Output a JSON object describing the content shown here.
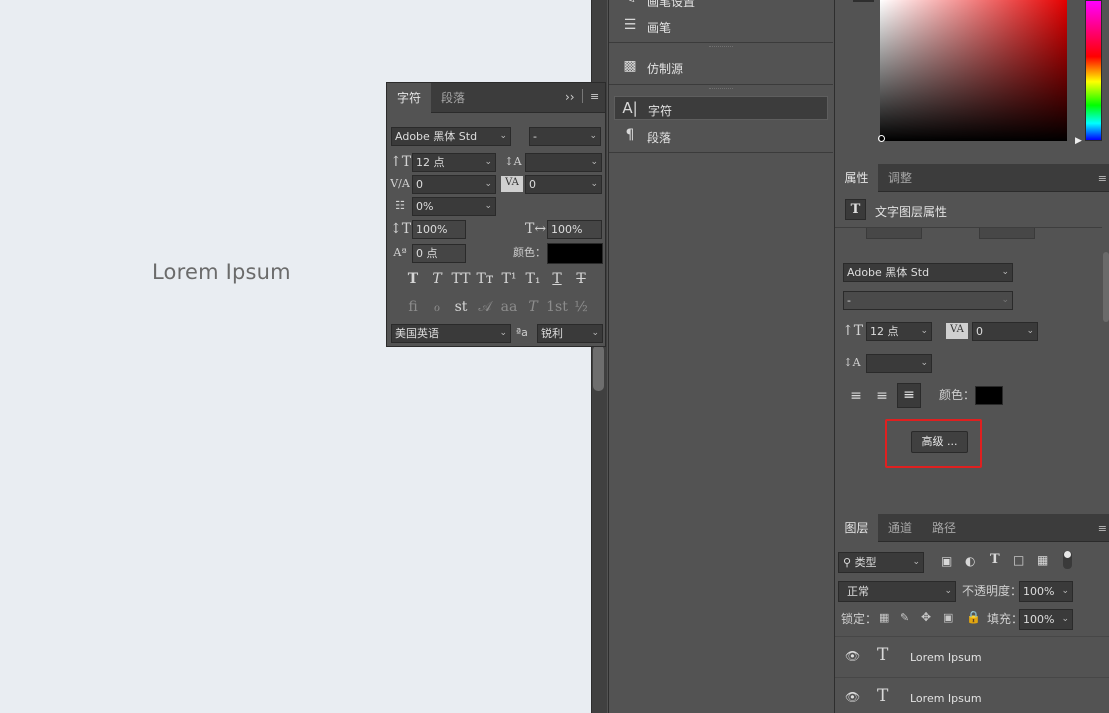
{
  "canvas": {
    "text": "Lorem Ipsum"
  },
  "character_panel": {
    "tabs": [
      "字符",
      "段落"
    ],
    "expand_icon": "double-chevron-right-icon",
    "font_family": "Adobe 黑体 Std",
    "font_style": "-",
    "font_size": "12 点",
    "leading": "",
    "kerning": "V/A 0",
    "tracking": "0",
    "tsume": "0%",
    "vertical_scale": "100%",
    "horizontal_scale": "100%",
    "baseline_shift": "0 点",
    "color_label": "颜色：",
    "color_value": "#000000",
    "glyph_row1": [
      "T",
      "T",
      "TT",
      "Tт",
      "T¹",
      "T₁",
      "T",
      "T"
    ],
    "glyph_row2": [
      "fi",
      "ℴ",
      "st",
      "𝒜",
      "aa",
      "T",
      "1st",
      "½"
    ],
    "language": "美国英语",
    "aa_label": "ªa",
    "antialias": "锐利"
  },
  "middle_panel": {
    "items": [
      {
        "label": "画笔设置",
        "icon": "brush-settings-icon"
      },
      {
        "label": "画笔",
        "icon": "brush-icon"
      },
      {
        "label": "仿制源",
        "icon": "clone-source-icon"
      },
      {
        "label": "字符",
        "icon": "character-icon"
      },
      {
        "label": "段落",
        "icon": "paragraph-icon"
      }
    ]
  },
  "properties_panel": {
    "tabs": [
      "属性",
      "调整"
    ],
    "header_label": "文字图层属性",
    "font_family": "Adobe 黑体 Std",
    "font_style": "-",
    "font_size": "12 点",
    "tracking": "0",
    "leading": "",
    "color_label": "颜色：",
    "color_value": "#000000",
    "advanced_button": "高级 ...",
    "highlight_color": "#e02020"
  },
  "layers_panel": {
    "tabs": [
      "图层",
      "通道",
      "路径"
    ],
    "filter_label": "类型",
    "blend_mode": "正常",
    "opacity_label": "不透明度：",
    "opacity_value": "100%",
    "lock_label": "锁定：",
    "fill_label": "填充：",
    "fill_value": "100%",
    "layers": [
      {
        "name": "Lorem Ipsum",
        "visible": true
      },
      {
        "name": "Lorem Ipsum",
        "visible": true
      }
    ]
  }
}
